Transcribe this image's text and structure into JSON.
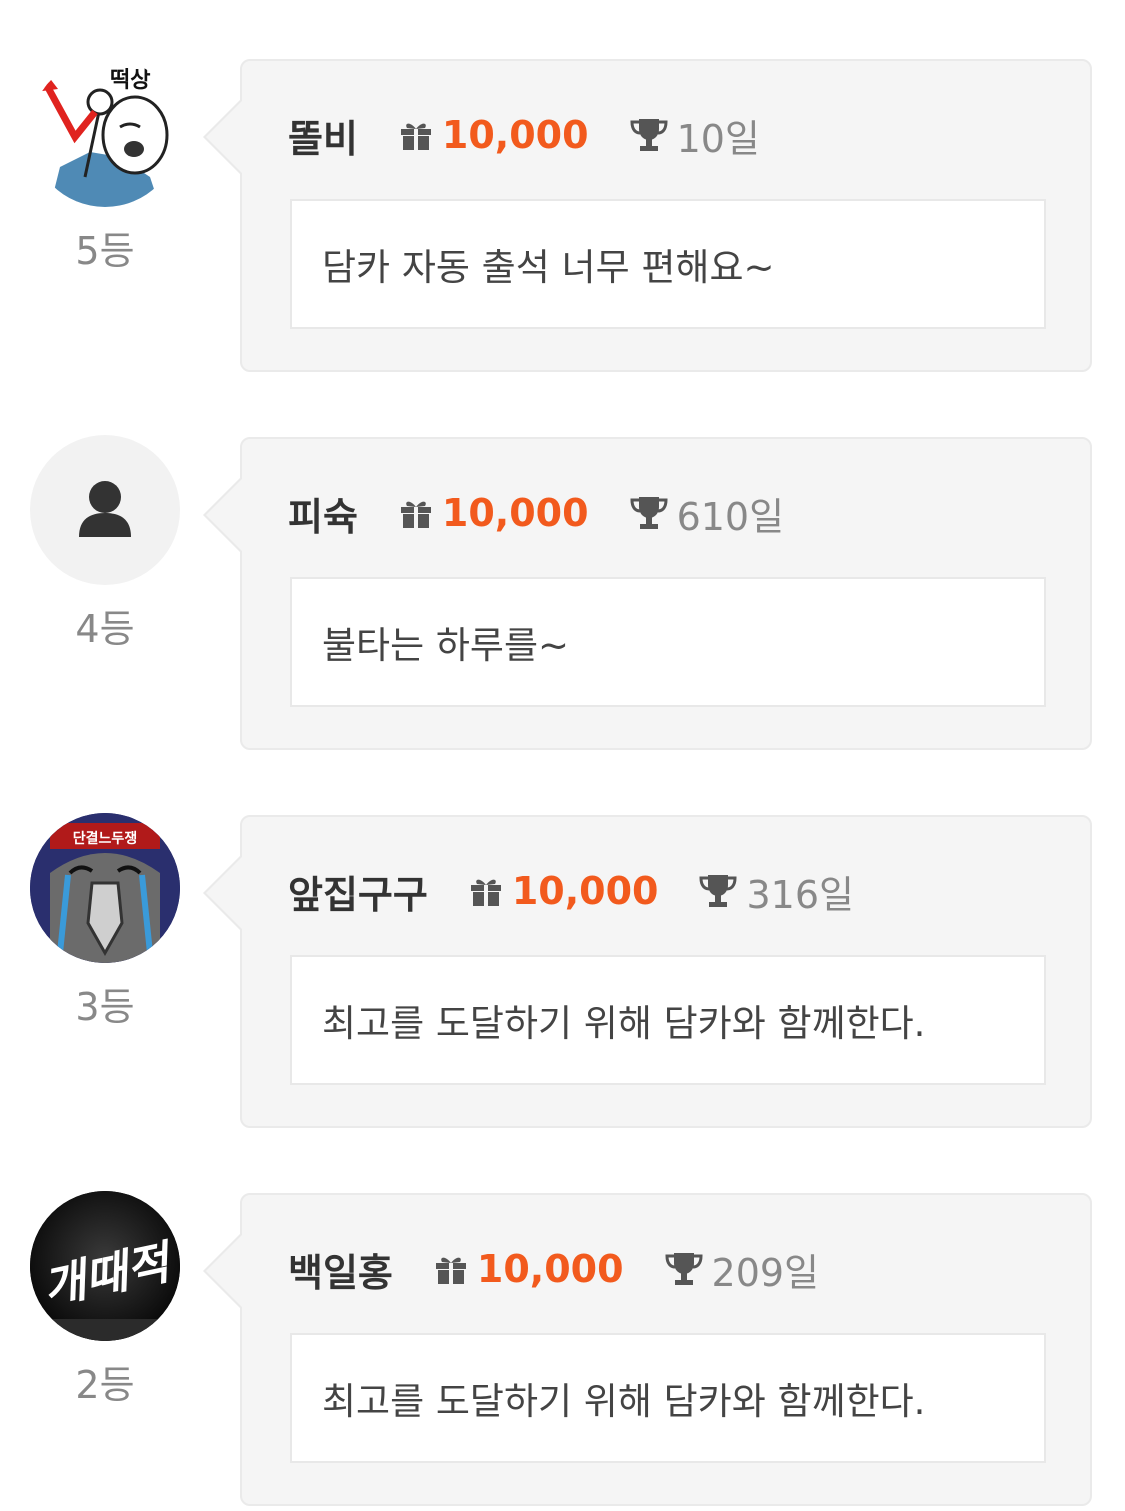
{
  "colors": {
    "points": "#f25a1d",
    "icon_gray": "#555555",
    "muted_text": "#888888"
  },
  "entries": [
    {
      "rank_label": "5등",
      "name": "똘비",
      "points": "10,000",
      "days": "10일",
      "message": "담카 자동 출석 너무 편해요~",
      "avatar": "avatar-image-meme",
      "avatar_text": "떡상"
    },
    {
      "rank_label": "4등",
      "name": "피슉",
      "points": "10,000",
      "days": "610일",
      "message": "불타는 하루를~",
      "avatar": "default-person-icon"
    },
    {
      "rank_label": "3등",
      "name": "앞집구구",
      "points": "10,000",
      "days": "316일",
      "message": "최고를 도달하기 위해 담카와 함께한다.",
      "avatar": "avatar-image-bird",
      "avatar_text": "단결느두쟁"
    },
    {
      "rank_label": "2등",
      "name": "백일홍",
      "points": "10,000",
      "days": "209일",
      "message": "최고를 도달하기 위해 담카와 함께한다.",
      "avatar": "avatar-image-neon",
      "avatar_text": "개때적"
    }
  ]
}
